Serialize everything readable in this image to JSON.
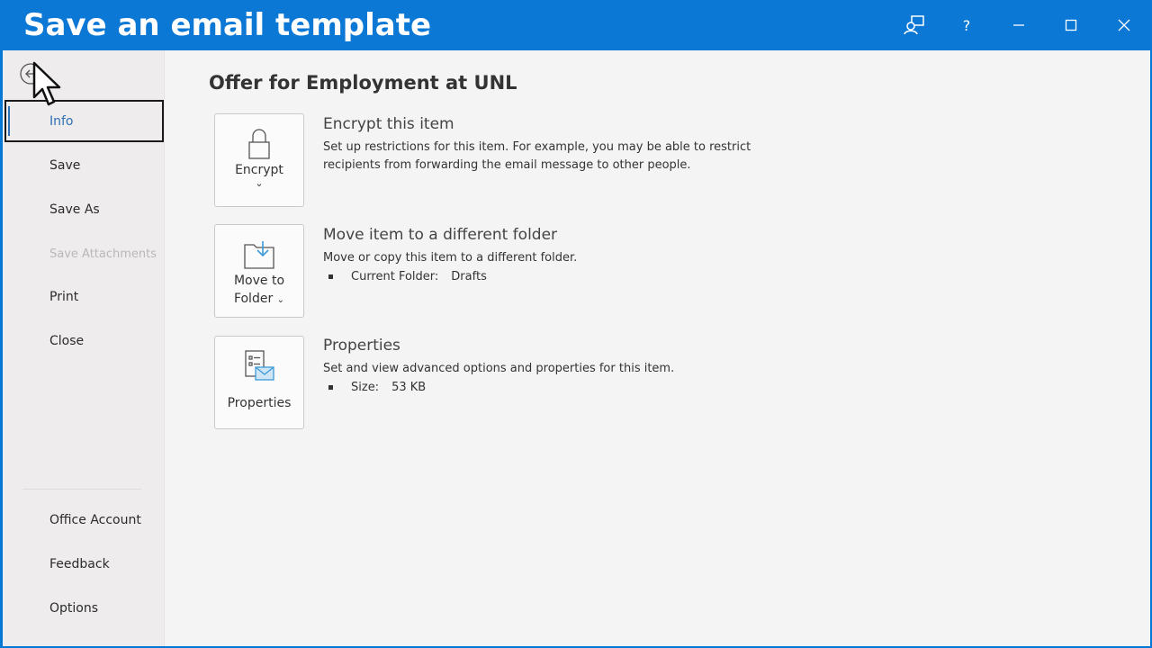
{
  "titlebar": {
    "title": "Save an email template",
    "icons": [
      "coauthor-icon",
      "help-icon",
      "minimize-icon",
      "maximize-icon",
      "close-icon"
    ],
    "help_label": "?"
  },
  "sidebar": {
    "back_icon": "back-arrow-icon",
    "items": [
      {
        "label": "Info",
        "state": "selected"
      },
      {
        "label": "Save",
        "state": "normal"
      },
      {
        "label": "Save As",
        "state": "normal"
      },
      {
        "label": "Save Attachments",
        "state": "disabled"
      },
      {
        "label": "Print",
        "state": "normal"
      },
      {
        "label": "Close",
        "state": "normal"
      }
    ],
    "bottom_items": [
      {
        "label": "Office Account"
      },
      {
        "label": "Feedback"
      },
      {
        "label": "Options"
      }
    ]
  },
  "main": {
    "title": "Offer for Employment at UNL",
    "sections": [
      {
        "button_label": "Encrypt",
        "button_chevron": "⌄",
        "icon": "lock-icon",
        "heading": "Encrypt this item",
        "description": "Set up restrictions for this item. For example, you may be able to restrict recipients from forwarding the email message to other people."
      },
      {
        "button_label_line1": "Move to",
        "button_label_line2": "Folder",
        "button_chevron": "⌄",
        "icon": "move-folder-icon",
        "heading": "Move item to a different folder",
        "description": "Move or copy this item to a different folder.",
        "detail_label": "Current Folder:",
        "detail_value": "Drafts"
      },
      {
        "button_label": "Properties",
        "icon": "properties-icon",
        "heading": "Properties",
        "description": "Set and view advanced options and properties for this item.",
        "detail_label": "Size:",
        "detail_value": "53 KB"
      }
    ]
  },
  "colors": {
    "titlebar": "#0b78d6",
    "accent": "#2f6fb5",
    "icon_blue": "#3c9ad8"
  }
}
